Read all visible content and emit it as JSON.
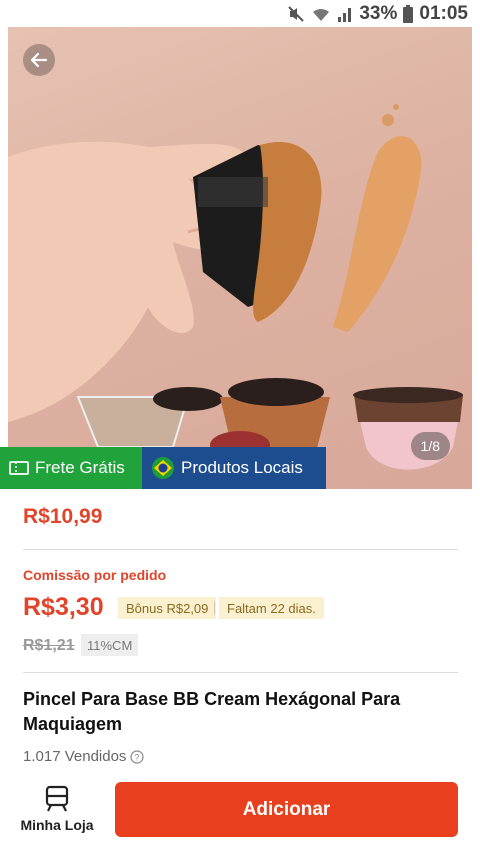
{
  "status_bar": {
    "battery": "33%",
    "time": "01:05",
    "icons": [
      "mute-icon",
      "wifi-icon",
      "signal-icon",
      "battery-icon"
    ]
  },
  "product_image": {
    "counter": "1/8"
  },
  "badges": {
    "frete": "Frete Grátis",
    "locais": "Produtos Locais"
  },
  "price": {
    "main": "R$10,99"
  },
  "commission": {
    "label": "Comissão por pedido",
    "value": "R$3,30",
    "bonus": "Bônus R$2,09",
    "faltam": "Faltam 22 dias.",
    "old_price": "R$1,21",
    "cm": "11%CM"
  },
  "product": {
    "title": "Pincel Para Base BB Cream Hexágonal Para Maquiagem",
    "sold": "1.017 Vendidos"
  },
  "bottom": {
    "store_label": "Minha Loja",
    "add_label": "Adicionar"
  },
  "colors": {
    "accent": "#e8401f",
    "price": "#e0452b",
    "frete_green": "#21a33b",
    "locais_blue": "#1d4c8f"
  }
}
